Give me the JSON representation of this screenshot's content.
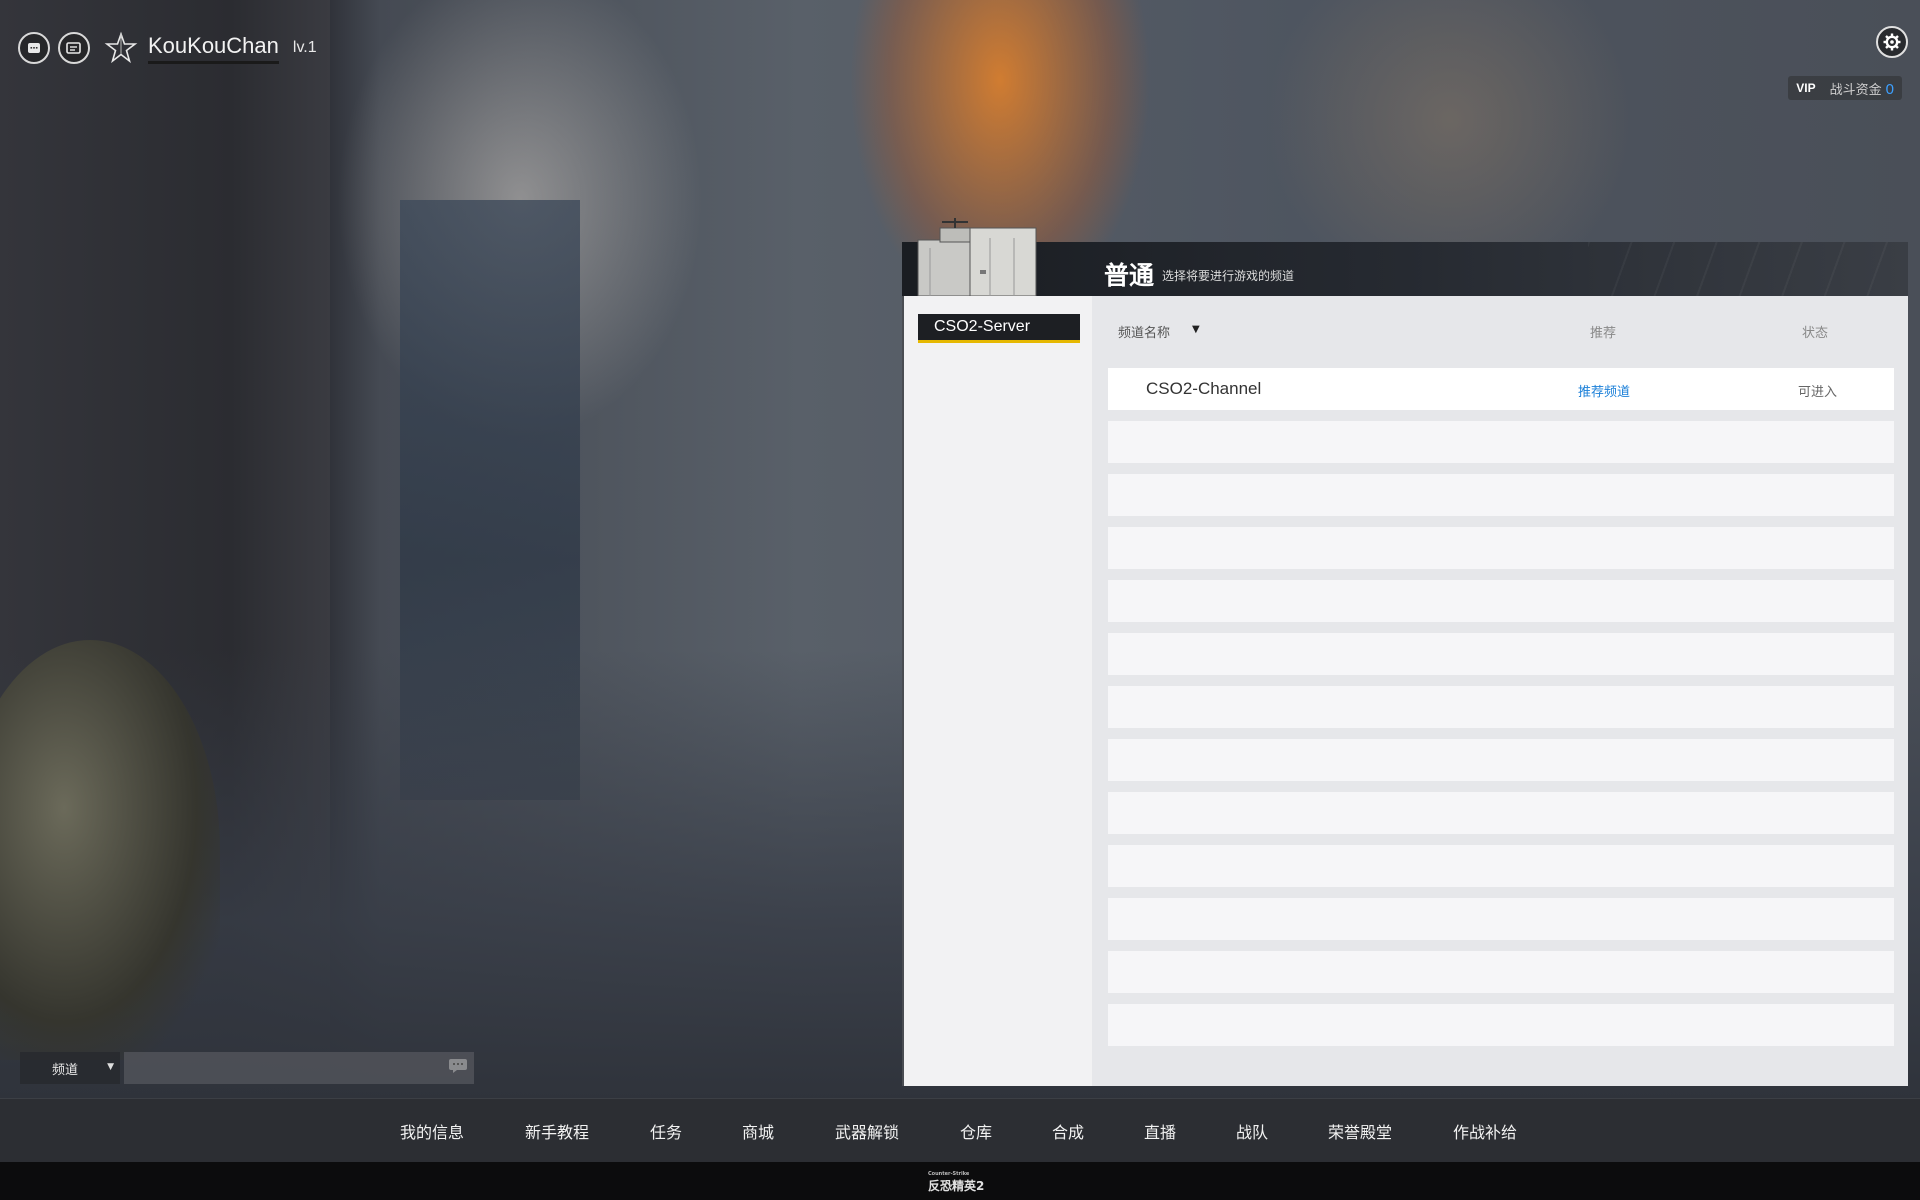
{
  "profile": {
    "username": "KouKouChan",
    "level": "lv.1"
  },
  "top_right": {
    "vip_label": "VIP",
    "funds_label": "战斗资金",
    "funds_value": "0"
  },
  "panel": {
    "title": "普通",
    "subtitle": "选择将要进行游戏的频道",
    "server_tab": "CSO2-Server",
    "columns": {
      "name": "频道名称",
      "recommend": "推荐",
      "status": "状态"
    },
    "channels": [
      {
        "name": "CSO2-Channel",
        "recommend": "推荐频道",
        "status": "可进入"
      }
    ],
    "empty_row_count": 12
  },
  "chat": {
    "channel_label": "频道",
    "input_value": ""
  },
  "bottom_nav": {
    "items": [
      "我的信息",
      "新手教程",
      "任务",
      "商城",
      "武器解锁",
      "仓库",
      "合成",
      "直播",
      "战队",
      "荣誉殿堂",
      "作战补给"
    ]
  },
  "footer": {
    "logo_text": "反恐精英2",
    "logo_top": "Counter-Strike"
  },
  "colors": {
    "accent_blue": "#1a7fd8",
    "funds_blue": "#3da0ff",
    "tab_underline": "#e6b800"
  }
}
